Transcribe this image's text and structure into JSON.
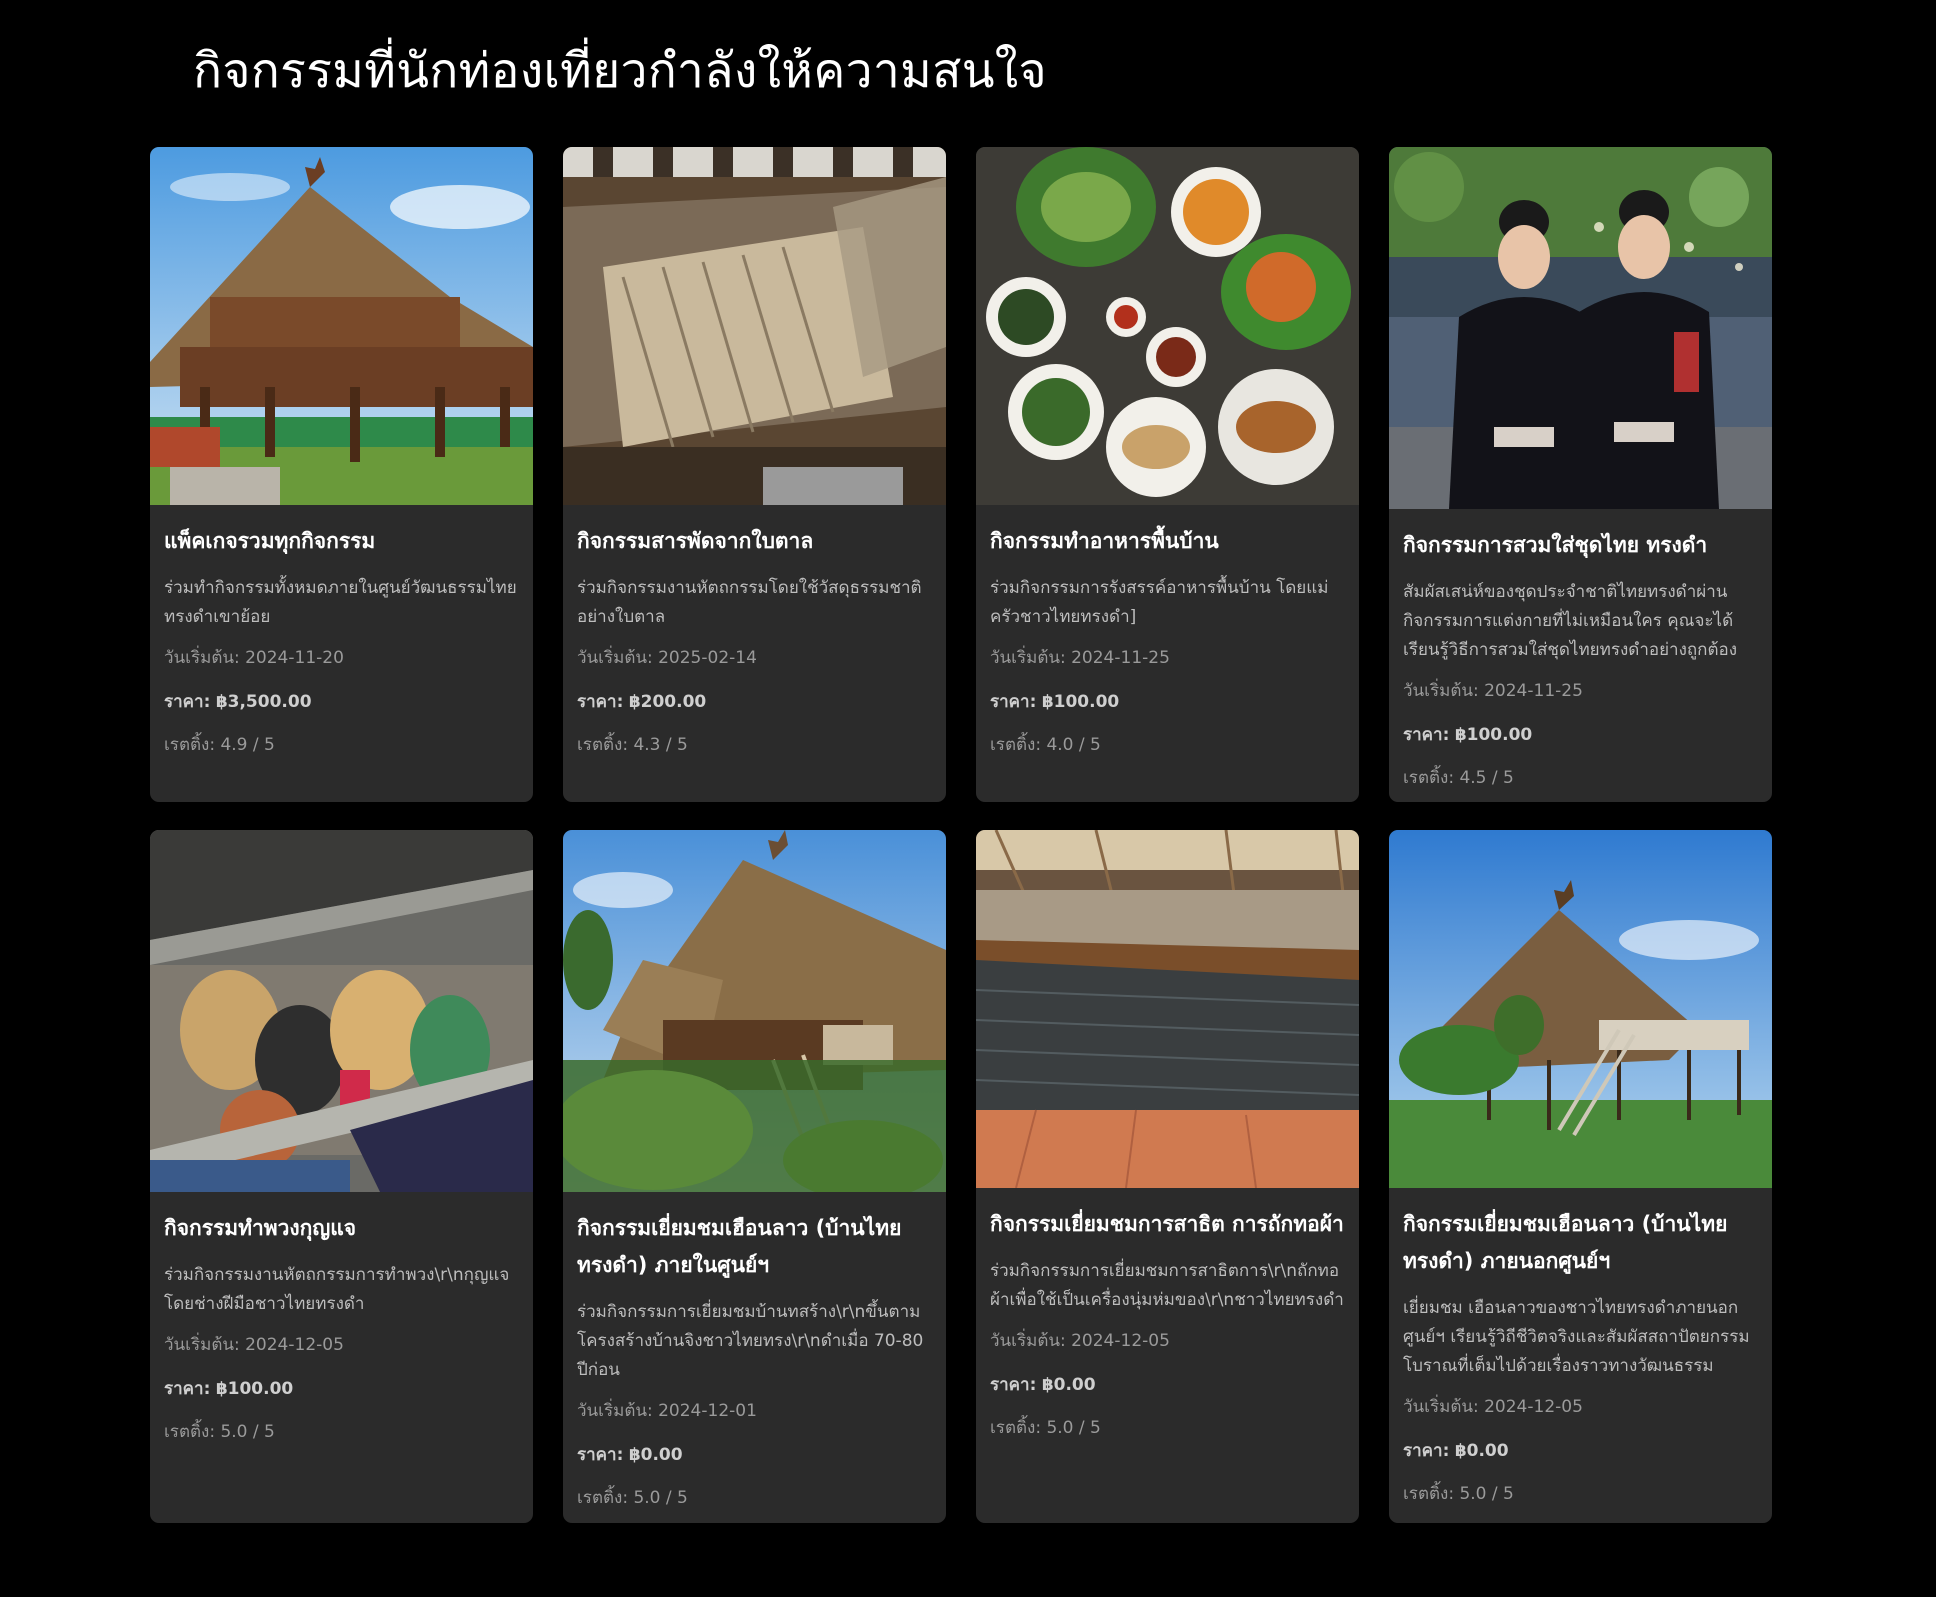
{
  "page": {
    "title": "กิจกรรมที่นักท่องเที่ยวกำลังให้ความสนใจ"
  },
  "labels": {
    "date_prefix": "วันเริ่มต้น: ",
    "price_prefix": "ราคา: ",
    "rating_prefix": "เรตติ้ง: "
  },
  "cards": [
    {
      "title": "แพ็คเกจรวมทุกกิจกรรม",
      "description": "ร่วมทำกิจกรรมทั้งหมดภายในศูนย์วัฒนธรรมไทยทรงดำเขาย้อย",
      "date": "วันเริ่มต้น: 2024-11-20",
      "price_label": "ราคา:",
      "price": "฿3,500.00",
      "rating": "เรตติ้ง: 4.9 / 5",
      "image": "thatched-wooden-pavilion-photo"
    },
    {
      "title": "กิจกรรมสารพัดจากใบตาล",
      "description": "ร่วมกิจกรรมงานหัตถกรรมโดยใช้วัสดุธรรมชาติอย่างใบตาล",
      "date": "วันเริ่มต้น: 2025-02-14",
      "price_label": "ราคา:",
      "price": "฿200.00",
      "rating": "เรตติ้ง: 4.3 / 5",
      "image": "palm-leaf-weaving-photo"
    },
    {
      "title": "กิจกรรมทำอาหารพื้นบ้าน",
      "description": "ร่วมกิจกรรมการรังสรรค์อาหารพื้นบ้าน โดยแม่ครัวชาวไทยทรงดำ]",
      "date": "วันเริ่มต้น: 2024-11-25",
      "price_label": "ราคา:",
      "price": "฿100.00",
      "rating": "เรตติ้ง: 4.0 / 5",
      "image": "local-food-dishes-photo"
    },
    {
      "title": "กิจกรรมการสวมใส่ชุดไทย ทรงดำ",
      "description": "สัมผัสเสน่ห์ของชุดประจำชาติไทยทรงดำผ่านกิจกรรมการแต่งกายที่ไม่เหมือนใคร คุณจะได้เรียนรู้วิธีการสวมใส่ชุดไทยทรงดำอย่างถูกต้อง",
      "date": "วันเริ่มต้น: 2024-11-25",
      "price_label": "ราคา:",
      "price": "฿100.00",
      "rating": "เรตติ้ง: 4.5 / 5",
      "image": "women-in-black-costume-photo"
    },
    {
      "title": "กิจกรรมทำพวงกุญแจ",
      "description": "ร่วมกิจกรรมงานหัตถกรรมการทำพวง\\r\\nกุญแจโดยช่างฝีมือชาวไทยทรงดำ",
      "date": "วันเริ่มต้น: 2024-12-05",
      "price_label": "ราคา:",
      "price": "฿100.00",
      "rating": "เรตติ้ง: 5.0 / 5",
      "image": "keychain-crafts-photo"
    },
    {
      "title": "กิจกรรมเยี่ยมชมเฮือนลาว (บ้านไทยทรงดำ) ภายในศูนย์ฯ",
      "description": "ร่วมกิจกรรมการเยี่ยมชมบ้านทสร้าง\\r\\nขึ้นตามโครงสร้างบ้านจิงชาวไทยทรง\\r\\nดำเมื่อ 70-80 ปีก่อน",
      "date": "วันเริ่มต้น: 2024-12-01",
      "price_label": "ราคา:",
      "price": "฿0.00",
      "rating": "เรตติ้ง: 5.0 / 5",
      "image": "thatched-house-inside-photo"
    },
    {
      "title": "กิจกรรมเยี่ยมชมการสาธิต การถักทอผ้า",
      "description": "ร่วมกิจกรรมการเยี่ยมชมการสาธิตการ\\r\\nถักทอผ้าเพื่อใช้เป็นเครื่องนุ่มห่มของ\\r\\nชาวไทยทรงดำ",
      "date": "วันเริ่มต้น: 2024-12-05",
      "price_label": "ราคา:",
      "price": "฿0.00",
      "rating": "เรตติ้ง: 5.0 / 5",
      "image": "weaving-loom-photo"
    },
    {
      "title": "กิจกรรมเยี่ยมชมเฮือนลาว (บ้านไทยทรงดำ) ภายนอกศูนย์ฯ",
      "description": "เยี่ยมชม เฮือนลาวของชาวไทยทรงดำภายนอกศูนย์ฯ เรียนรู้วิถีชีวิตจริงและสัมผัสสถาปัตยกรรมโบราณที่เต็มไปด้วยเรื่องราวทางวัฒนธรรม",
      "date": "วันเริ่มต้น: 2024-12-05",
      "price_label": "ราคา:",
      "price": "฿0.00",
      "rating": "เรตติ้ง: 5.0 / 5",
      "image": "thatched-house-outside-photo"
    }
  ]
}
